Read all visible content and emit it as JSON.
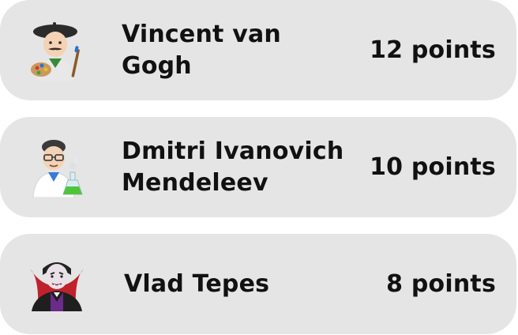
{
  "leaderboard": {
    "entries": [
      {
        "name": "Vincent van Gogh",
        "points": "12 points",
        "avatar_icon": "artist-emoji-icon"
      },
      {
        "name": "Dmitri Ivanovich Mendeleev",
        "points": "10 points",
        "avatar_icon": "scientist-emoji-icon"
      },
      {
        "name": "Vlad Tepes",
        "points": "8 points",
        "avatar_icon": "vampire-emoji-icon"
      }
    ]
  },
  "colors": {
    "card_background": "#e5e5e5",
    "text": "#111111"
  }
}
